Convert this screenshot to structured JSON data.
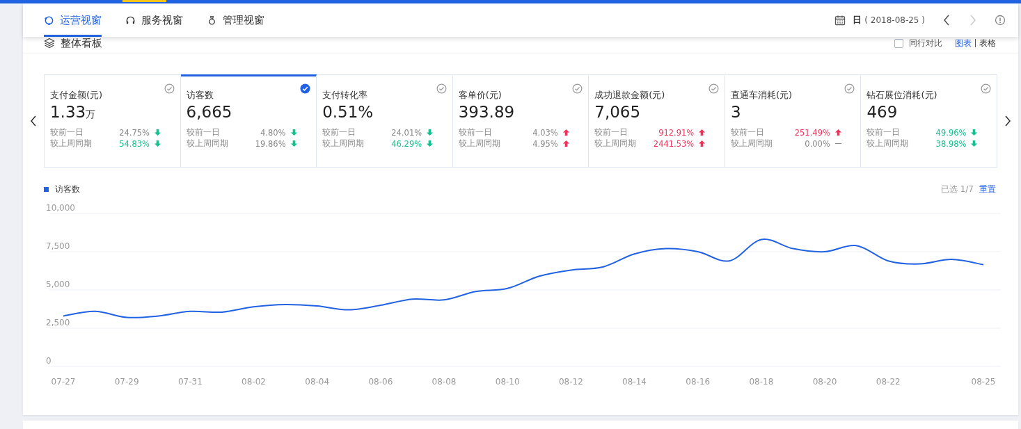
{
  "nav": {
    "tabs": [
      {
        "label": "运营视窗",
        "selected": true
      },
      {
        "label": "服务视窗",
        "selected": false
      },
      {
        "label": "管理视窗",
        "selected": false
      }
    ],
    "period": "日",
    "date": "( 2018-08-25 )",
    "prev_disabled": false,
    "next_disabled": true
  },
  "panel": {
    "title": "整体看板",
    "compare": {
      "label": "同行对比",
      "checked": false
    },
    "views": [
      {
        "label": "图表",
        "selected": true
      },
      {
        "label": "表格",
        "selected": false
      }
    ]
  },
  "metrics": [
    {
      "label": "支付金额(元)",
      "value": "1.33",
      "unit": "万",
      "selected": false,
      "rows": [
        {
          "label": "较前一日",
          "value": "24.75%",
          "kind": "down",
          "highlighted": false
        },
        {
          "label": "较上周同期",
          "value": "54.83%",
          "kind": "down",
          "highlighted": true
        }
      ]
    },
    {
      "label": "访客数",
      "value": "6,665",
      "selected": true,
      "rows": [
        {
          "label": "较前一日",
          "value": "4.80%",
          "kind": "down",
          "highlighted": false
        },
        {
          "label": "较上周同期",
          "value": "19.86%",
          "kind": "down",
          "highlighted": false
        }
      ]
    },
    {
      "label": "支付转化率",
      "value": "0.51%",
      "selected": false,
      "rows": [
        {
          "label": "较前一日",
          "value": "24.01%",
          "kind": "down",
          "highlighted": false
        },
        {
          "label": "较上周同期",
          "value": "46.29%",
          "kind": "down",
          "highlighted": true
        }
      ]
    },
    {
      "label": "客单价(元)",
      "value": "393.89",
      "selected": false,
      "rows": [
        {
          "label": "较前一日",
          "value": "4.03%",
          "kind": "up",
          "highlighted": false
        },
        {
          "label": "较上周同期",
          "value": "4.95%",
          "kind": "up",
          "highlighted": false
        }
      ]
    },
    {
      "label": "成功退款金额(元)",
      "value": "7,065",
      "selected": false,
      "rows": [
        {
          "label": "较前一日",
          "value": "912.91%",
          "kind": "up",
          "highlighted": true
        },
        {
          "label": "较上周同期",
          "value": "2441.53%",
          "kind": "up",
          "highlighted": true
        }
      ]
    },
    {
      "label": "直通车消耗(元)",
      "value": "3",
      "selected": false,
      "rows": [
        {
          "label": "较前一日",
          "value": "251.49%",
          "kind": "up",
          "highlighted": true
        },
        {
          "label": "较上周同期",
          "value": "0.00%",
          "kind": "flat"
        }
      ]
    },
    {
      "label": "钻石展位消耗(元)",
      "value": "469",
      "selected": false,
      "rows": [
        {
          "label": "较前一日",
          "value": "49.96%",
          "kind": "down",
          "highlighted": true
        },
        {
          "label": "较上周同期",
          "value": "38.98%",
          "kind": "down",
          "highlighted": true
        }
      ]
    }
  ],
  "chart": {
    "selected_count": "已选 1/7",
    "reset": "重置",
    "chart_data": {
      "type": "line",
      "categories": [
        "07-27",
        null,
        "07-29",
        null,
        "07-31",
        null,
        "08-02",
        null,
        "08-04",
        null,
        "08-06",
        null,
        "08-08",
        null,
        "08-10",
        null,
        "08-12",
        null,
        "08-14",
        null,
        "08-16",
        null,
        "08-18",
        null,
        "08-20",
        null,
        "08-22",
        null,
        null,
        "08-25"
      ],
      "grid": true,
      "series": [
        {
          "name": "访客数",
          "color": "#2162e3",
          "values": [
            3300,
            3600,
            3200,
            3300,
            3600,
            3550,
            3900,
            4050,
            3950,
            3700,
            4000,
            4400,
            4350,
            4900,
            5100,
            5900,
            6300,
            6500,
            7350,
            7700,
            7500,
            6900,
            8300,
            7700,
            7500,
            7900,
            6900,
            6700,
            7000,
            6650
          ]
        }
      ],
      "ylim": [
        0,
        10000
      ],
      "yticks": [
        {
          "value": 0,
          "label": "0"
        },
        {
          "value": 2500,
          "label": "2,500"
        },
        {
          "value": 5000,
          "label": "5,000"
        },
        {
          "value": 7500,
          "label": "7,500"
        },
        {
          "value": 10000,
          "label": "10,000"
        }
      ]
    }
  }
}
